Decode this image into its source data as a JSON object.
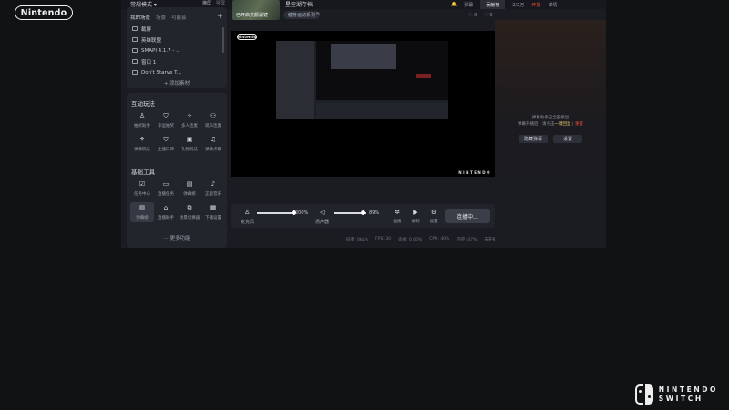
{
  "brand": {
    "nintendo": "Nintendo",
    "switch_line1": "NINTENDO",
    "switch_line2": "SWITCH"
  },
  "topbar": {
    "mode": "常规模式 ▾",
    "screen_a": "横屏",
    "screen_b": "竖屏",
    "cover_caption": "已开启美颜滤镜",
    "room_title": "星空湖存档",
    "room_tag": "健身运动系列",
    "right": [
      "弹幕",
      "贡献榜",
      "2/2万",
      "开播",
      "详情"
    ],
    "stats": [
      "0",
      "0"
    ]
  },
  "scenes": {
    "tabs": [
      "我的场景",
      "场景",
      "可能会"
    ],
    "add": "+",
    "items": [
      "截屏",
      "英雄联盟",
      "SMAPI 4.1.7 - ...",
      "窗口 1",
      "Don't Starve T..."
    ],
    "add_source": "+ 添加素材"
  },
  "interactive": {
    "title": "互动玩法",
    "tools": [
      "抽奖助手",
      "幸运抽奖",
      "多人连麦",
      "观众连麦",
      "弹幕玩法",
      "主播口碑",
      "礼物玩法",
      "弹幕点歌"
    ]
  },
  "basic": {
    "title": "基础工具",
    "tools": [
      "任务中心",
      "直播任务",
      "弹幕姬",
      "正版音乐",
      "弹幕姬",
      "直播助手",
      "场景切换器",
      "下播设置"
    ],
    "more": "··· 更多功能"
  },
  "controls": {
    "mic_label": "麦克风",
    "mic_value": "200%",
    "mic_level": 1.0,
    "speaker_label": "扬声器",
    "speaker_value": "89%",
    "speaker_level": 0.89,
    "buttons": [
      "画质",
      "录制",
      "设置"
    ],
    "live_button": "连播中..."
  },
  "status": [
    "码率: 0kb/s",
    "FPS: 30",
    "丢帧: 0.00%",
    "CPU: 40%",
    "内存: 47%",
    "未开播"
  ],
  "danmu": {
    "line1": "弹幕助手已全部接出",
    "line2_pre": "弹幕开播后，请点击",
    "link_a": "一键回显",
    "link_b": "重置",
    "btn_a": "隐藏弹幕",
    "btn_b": "设置"
  },
  "colors": {
    "accent_red": "#e74b3c",
    "accent_gold": "#e6c36a",
    "panel": "#23252c",
    "window": "#1a1c22"
  }
}
